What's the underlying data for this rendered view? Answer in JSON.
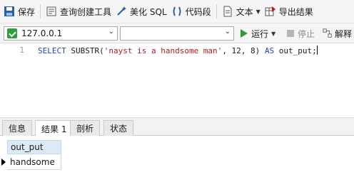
{
  "toolbar": {
    "save": "保存",
    "query_builder": "查询创建工具",
    "beautify_sql": "美化 SQL",
    "code_snippet": "代码段",
    "text": "文本",
    "export_results": "导出结果"
  },
  "toolbar2": {
    "connection": "127.0.0.1",
    "database": "",
    "run": "运行",
    "stop": "停止",
    "explain": "解释"
  },
  "editor": {
    "line_number": "1",
    "tokens": {
      "select": "SELECT",
      "func": " SUBSTR(",
      "string": "'nayst is a handsome man'",
      "args": ", 12, 8) ",
      "as": "AS",
      "alias": " out_put;"
    }
  },
  "tabs": [
    "信息",
    "结果 1",
    "剖析",
    "状态"
  ],
  "active_tab": "结果 1",
  "results": {
    "columns": [
      "out_put"
    ],
    "rows": [
      [
        "handsome"
      ]
    ]
  },
  "colors": {
    "keyword": "#1e46c8",
    "string": "#c8141e",
    "run_green": "#2fa02f",
    "header_blue": "#dce9f7"
  }
}
